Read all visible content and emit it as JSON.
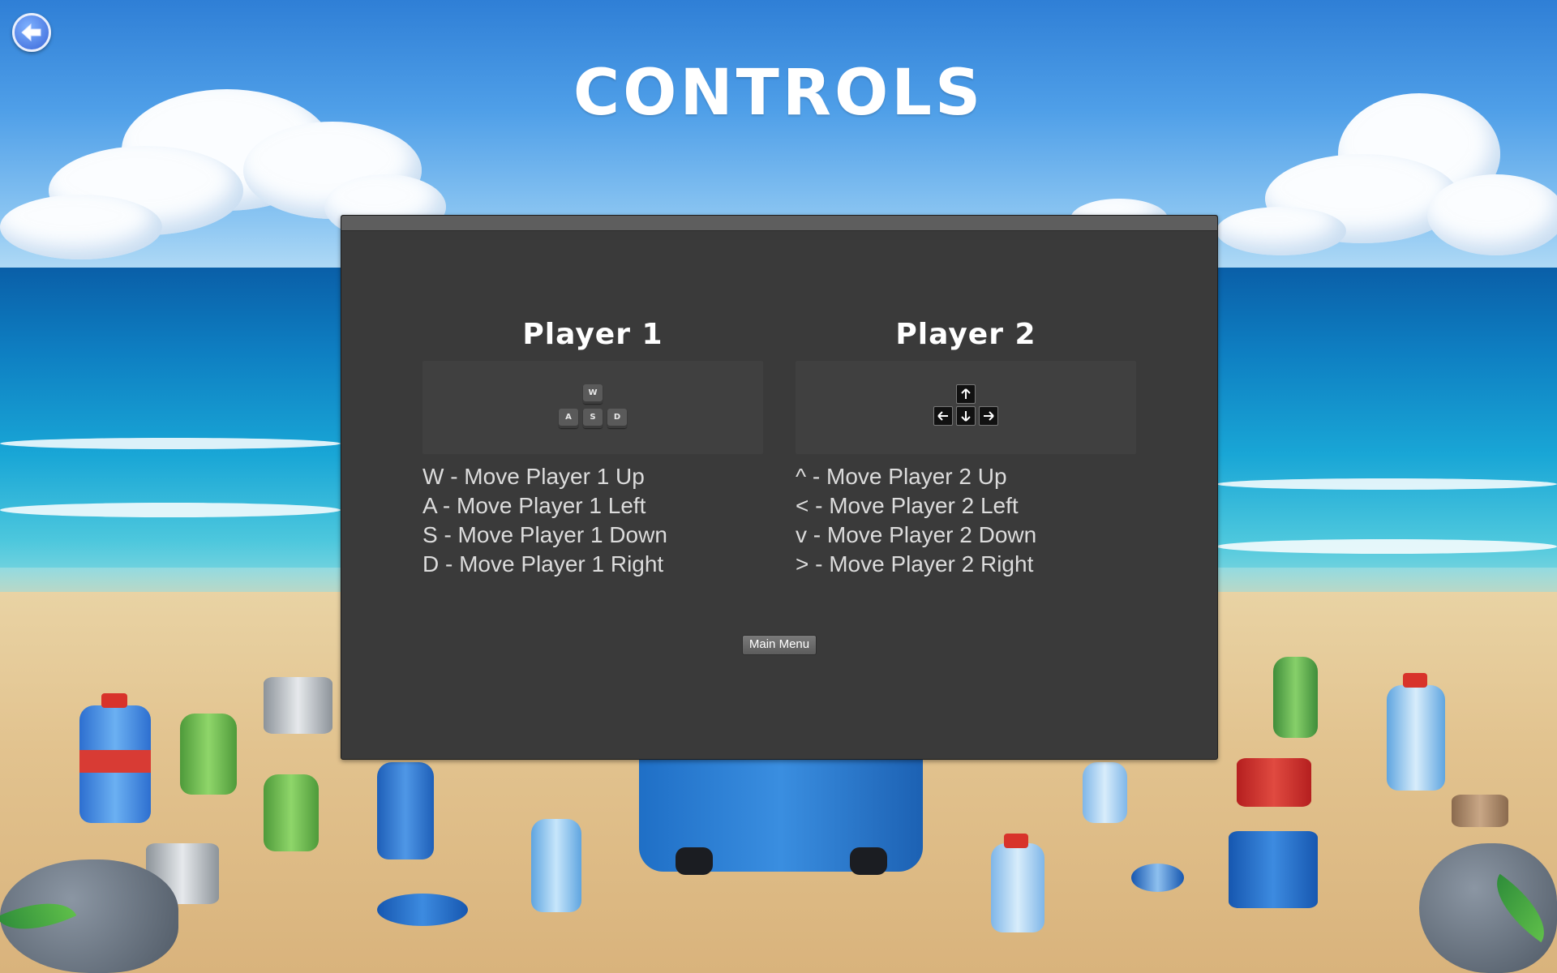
{
  "title": "CONTROLS",
  "back_icon": "arrow-left-icon",
  "player1": {
    "title": "Player 1",
    "keys": [
      "W",
      "A",
      "S",
      "D"
    ],
    "lines": [
      "W - Move Player 1 Up",
      "A - Move Player 1 Left",
      "S - Move Player 1 Down",
      "D - Move Player 1 Right"
    ]
  },
  "player2": {
    "title": "Player 2",
    "keys": [
      "arrow-up-icon",
      "arrow-left-icon",
      "arrow-down-icon",
      "arrow-right-icon"
    ],
    "lines": [
      "^ - Move Player 2 Up",
      "< - Move Player 2 Left",
      "v - Move Player 2 Down",
      "> - Move Player 2 Right"
    ]
  },
  "main_menu_label": "Main Menu",
  "colors": {
    "panel": "#3a3a3a",
    "title": "#ffffff",
    "text": "#dcdcdc",
    "back_button": "#3a66d8"
  }
}
